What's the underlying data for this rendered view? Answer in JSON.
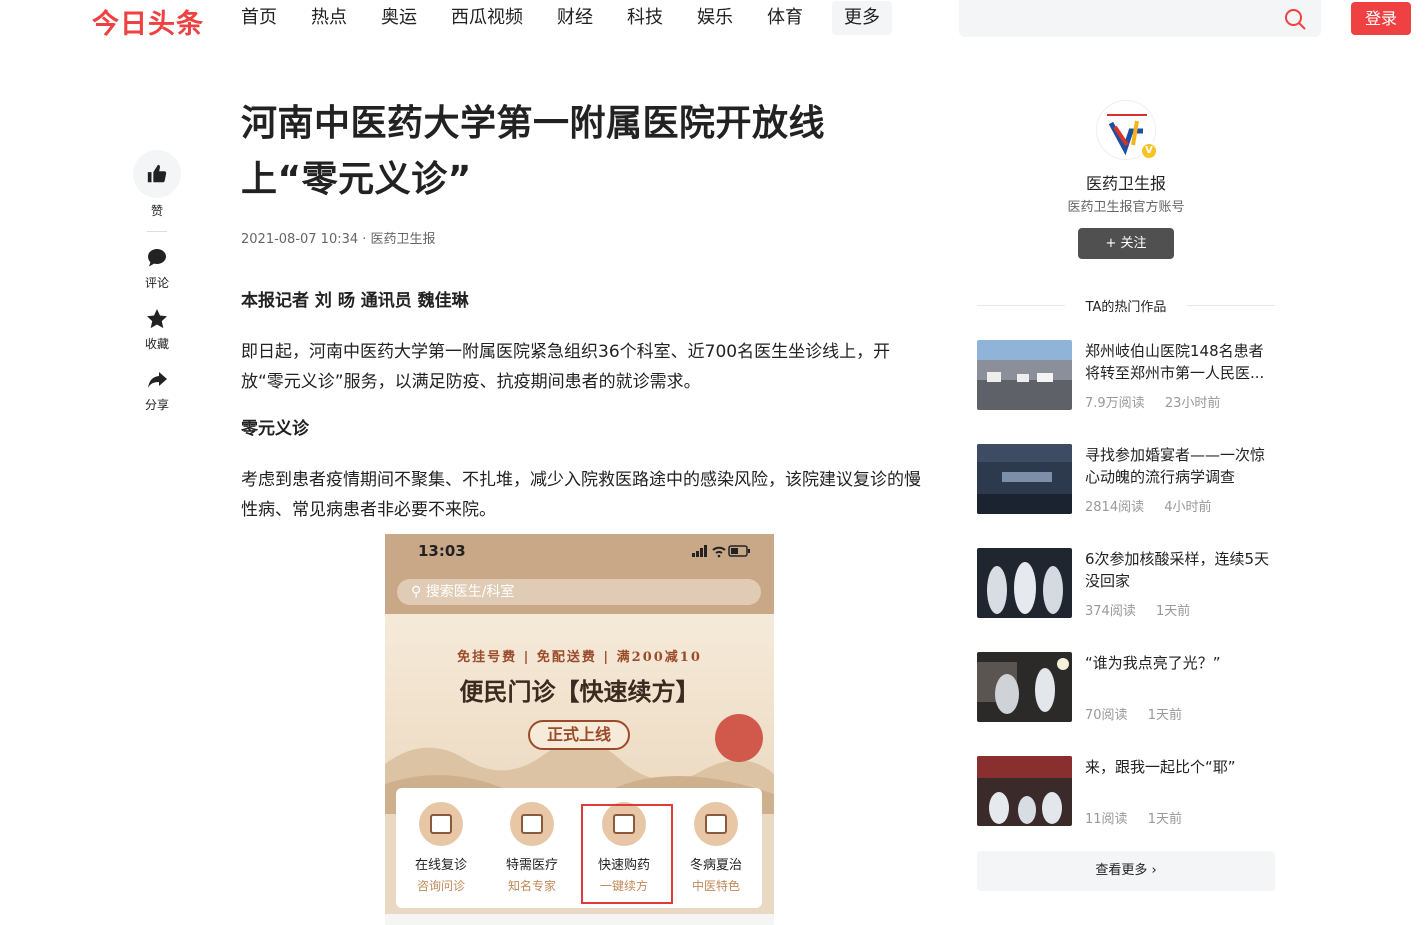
{
  "header": {
    "logo": "今日头条",
    "nav": [
      "首页",
      "热点",
      "奥运",
      "西瓜视频",
      "财经",
      "科技",
      "娱乐",
      "体育"
    ],
    "more": "更多",
    "search_placeholder": "",
    "login": "登录"
  },
  "actions": {
    "like": "赞",
    "comment": "评论",
    "favorite": "收藏",
    "share": "分享"
  },
  "article": {
    "title": "河南中医药大学第一附属医院开放线上“零元义诊”",
    "meta": "2021-08-07 10:34 · 医药卫生报",
    "byline": "本报记者 刘 旸 通讯员 魏佳琳",
    "para1": "即日起，河南中医药大学第一附属医院紧急组织36个科室、近700名医生坐诊线上，开放“零元义诊”服务，以满足防疫、抗疫期间患者的就诊需求。",
    "subhead": "零元义诊",
    "para2": "考虑到患者疫情期间不聚集、不扎堆，减少入院救医路途中的感染风险，该院建议复诊的慢性病、常见病患者非必要不来院。"
  },
  "phone": {
    "time": "13:03",
    "search": "搜索医生/科室",
    "tags": "免挂号费 | 免配送费 | 满200减10",
    "banner_title": "便民门诊【快速续方】",
    "badge": "正式上线",
    "services": [
      {
        "name": "在线复诊",
        "sub": "咨询问诊"
      },
      {
        "name": "特需医疗",
        "sub": "知名专家"
      },
      {
        "name": "快速购药",
        "sub": "一键续方"
      },
      {
        "name": "冬病夏治",
        "sub": "中医特色"
      }
    ]
  },
  "sidebar": {
    "author_name": "医药卫生报",
    "author_desc": "医药卫生报官方账号",
    "follow": "+ 关注",
    "hot_title": "TA的热门作品",
    "items": [
      {
        "title": "郑州岐伯山医院148名患者将转至郑州市第一人民医...",
        "reads": "7.9万阅读",
        "time": "23小时前",
        "color": "#7a8fa6"
      },
      {
        "title": "寻找参加婚宴者——一次惊心动魄的流行病学调查",
        "reads": "2814阅读",
        "time": "4小时前",
        "color": "#3c4a5e"
      },
      {
        "title": "6次参加核酸采样，连续5天没回家",
        "reads": "374阅读",
        "time": "1天前",
        "color": "#2b3340"
      },
      {
        "title": "“谁为我点亮了光？”",
        "reads": "70阅读",
        "time": "1天前",
        "color": "#4a4038"
      },
      {
        "title": "来，跟我一起比个“耶”",
        "reads": "11阅读",
        "time": "1天前",
        "color": "#6a3a3a"
      }
    ],
    "see_more": "查看更多"
  },
  "colors": {
    "brand": "#f04142",
    "follow_bg": "#505050",
    "highlight": "#e03a3a"
  }
}
